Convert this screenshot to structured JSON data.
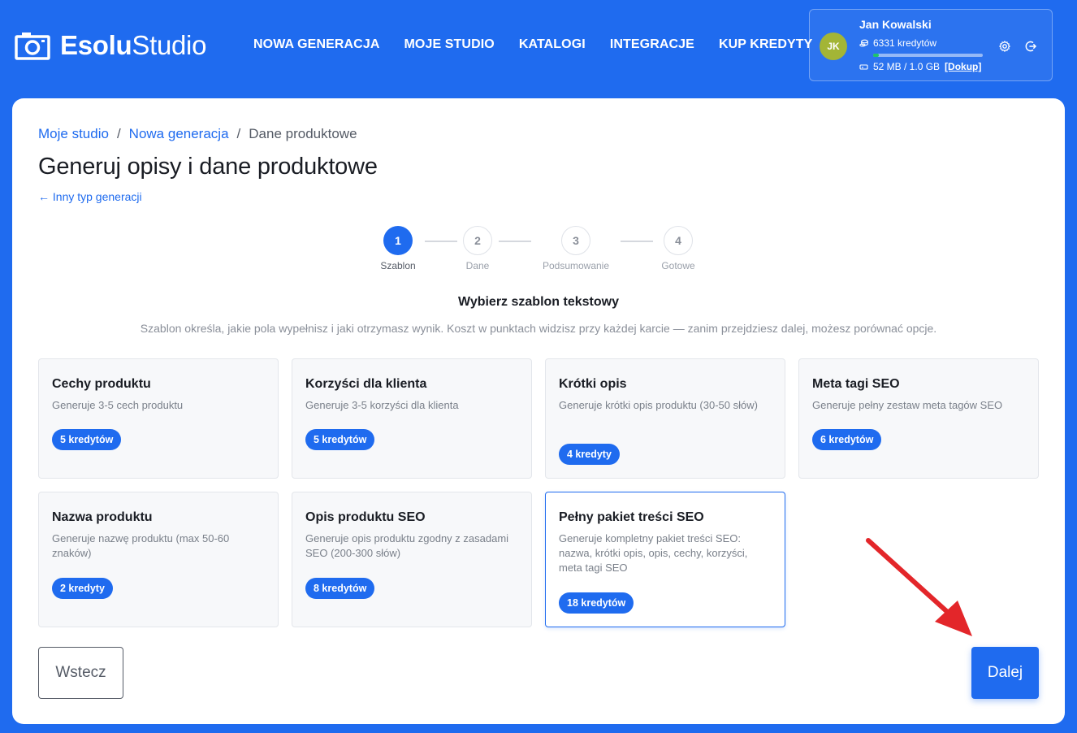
{
  "brand": {
    "bold": "Esolu",
    "light": "Studio"
  },
  "nav": [
    {
      "label": "NOWA GENERACJA"
    },
    {
      "label": "MOJE STUDIO"
    },
    {
      "label": "KATALOGI"
    },
    {
      "label": "INTEGRACJE"
    },
    {
      "label": "KUP KREDYTY"
    }
  ],
  "user": {
    "initials": "JK",
    "name": "Jan Kowalski",
    "credits": "6331 kredytów",
    "storage": "52 MB / 1.0 GB",
    "storage_fraction": 0.05,
    "topup": "[Dokup]"
  },
  "breadcrumb": {
    "home": "Moje studio",
    "sep1": "/",
    "middle": "Nowa generacja",
    "sep2": "/",
    "current": "Dane produktowe"
  },
  "title": "Generuj opisy i dane produktowe",
  "back_link": "← Inny typ generacji",
  "steps": [
    {
      "number": "1",
      "label": "Szablon",
      "active": true
    },
    {
      "number": "2",
      "label": "Dane",
      "active": false
    },
    {
      "number": "3",
      "label": "Podsumowanie",
      "active": false
    },
    {
      "number": "4",
      "label": "Gotowe",
      "active": false
    }
  ],
  "section": {
    "title": "Wybierz szablon tekstowy",
    "description": "Szablon określa, jakie pola wypełnisz i jaki otrzymasz wynik. Koszt w punktach widzisz przy każdej karcie — zanim przejdziesz dalej, możesz porównać opcje."
  },
  "templates": [
    {
      "title": "Cechy produktu",
      "description": "Generuje 3-5 cech produktu",
      "cost": "5 kredytów",
      "selected": false
    },
    {
      "title": "Korzyści dla klienta",
      "description": "Generuje 3-5 korzyści dla klienta",
      "cost": "5 kredytów",
      "selected": false
    },
    {
      "title": "Krótki opis",
      "description": "Generuje krótki opis produktu (30-50 słów)",
      "cost": "4 kredyty",
      "selected": false
    },
    {
      "title": "Meta tagi SEO",
      "description": "Generuje pełny zestaw meta tagów SEO",
      "cost": "6 kredytów",
      "selected": false
    },
    {
      "title": "Nazwa produktu",
      "description": "Generuje nazwę produktu (max 50-60 znaków)",
      "cost": "2 kredyty",
      "selected": false
    },
    {
      "title": "Opis produktu SEO",
      "description": "Generuje opis produktu zgodny z zasadami SEO (200-300 słów)",
      "cost": "8 kredytów",
      "selected": false
    },
    {
      "title": "Pełny pakiet treści SEO",
      "description": "Generuje kompletny pakiet treści SEO: nazwa, krótki opis, opis, cechy, korzyści, meta tagi SEO",
      "cost": "18 kredytów",
      "selected": true
    }
  ],
  "buttons": {
    "back": "Wstecz",
    "next": "Dalej"
  },
  "colors": {
    "primary": "#1f6bef",
    "avatar": "#a3b536",
    "progress": "#1ec36a",
    "arrow": "#e3262a"
  }
}
